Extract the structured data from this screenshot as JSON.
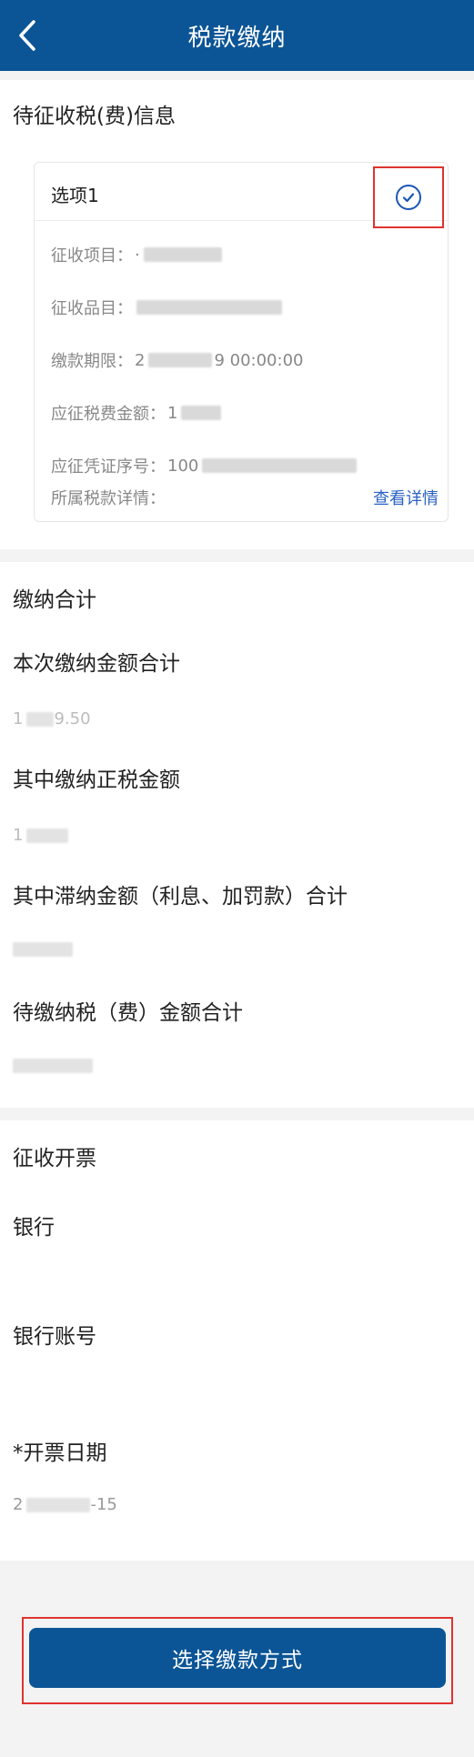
{
  "header": {
    "title": "税款缴纳",
    "back_icon": "chevron-left-icon"
  },
  "info_section": {
    "title": "待征收税(费)信息",
    "card": {
      "option_label": "选项1",
      "check_icon": "check-circle-icon",
      "rows": [
        {
          "label": "征收项目：",
          "value": "·"
        },
        {
          "label": "征收品目：",
          "value": ""
        },
        {
          "label": "缴款期限：",
          "value_prefix": "2",
          "value_suffix": "9 00:00:00"
        },
        {
          "label": "应征税费金额：",
          "value_prefix": "1"
        },
        {
          "label": "应征凭证序号：",
          "value_prefix": "100"
        },
        {
          "label": "所属税款详情：",
          "link": "查看详情"
        }
      ]
    }
  },
  "summary_section": {
    "title": "缴纳合计",
    "items": [
      {
        "label": "本次缴纳金额合计",
        "value_prefix": "1",
        "value_suffix": "9.50"
      },
      {
        "label": "其中缴纳正税金额",
        "value_prefix": "1"
      },
      {
        "label": "其中滞纳金额（利息、加罚款）合计",
        "value_prefix": ""
      },
      {
        "label": "待缴纳税（费）金额合计",
        "value_prefix": ""
      }
    ]
  },
  "invoice_section": {
    "title": "征收开票",
    "bank_label": "银行",
    "bank_account_label": "银行账号",
    "invoice_date_label": "*开票日期",
    "invoice_date_prefix": "2",
    "invoice_date_suffix": "-15"
  },
  "footer": {
    "pay_button_label": "选择缴款方式"
  },
  "colors": {
    "primary": "#0b5596",
    "link": "#2a62c5",
    "highlight": "#e0332f"
  }
}
